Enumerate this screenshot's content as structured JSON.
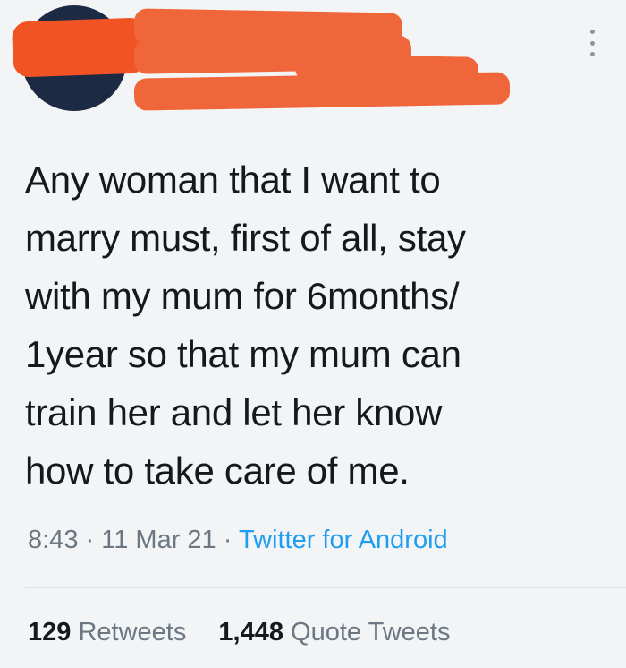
{
  "tweet": {
    "text": "Any woman that I want to\nmarry must, first of all, stay\nwith my mum for 6months/\n1year so that my mum can\ntrain her and let her know\nhow to take care of me.",
    "time": "8:43",
    "date": "11 Mar 21",
    "source": "Twitter for Android",
    "separator": "·"
  },
  "stats": {
    "retweets_count": "129",
    "retweets_label": "Retweets",
    "quotes_count": "1,448",
    "quotes_label": "Quote Tweets"
  },
  "icons": {
    "more": "more-vertical-icon"
  },
  "colors": {
    "redaction": "#f0663b",
    "link": "#1f9df1",
    "muted": "#6b7783",
    "text": "#16191c"
  }
}
